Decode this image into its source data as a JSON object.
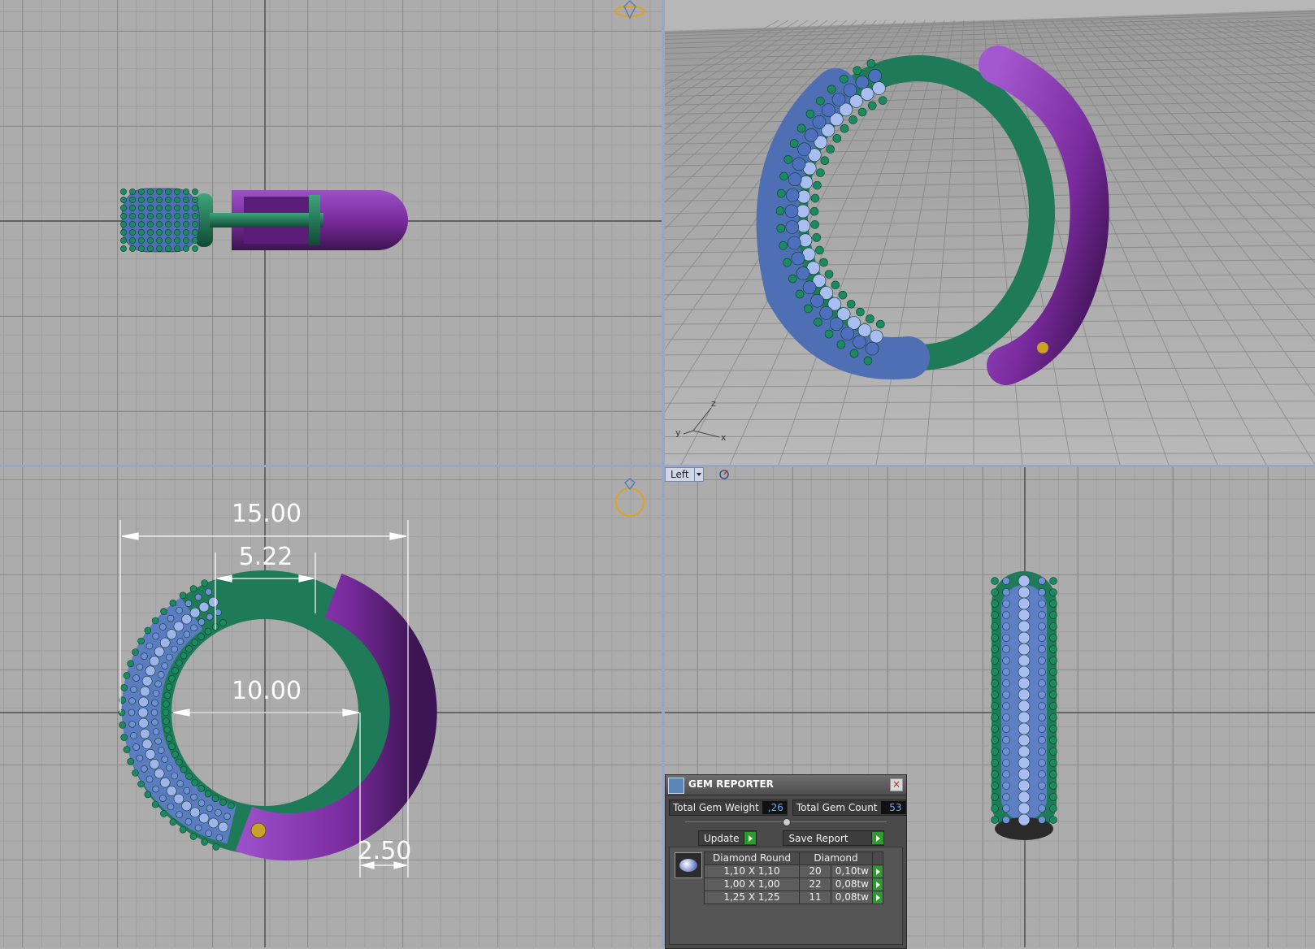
{
  "viewports": {
    "bottom_right_view": "Left"
  },
  "dimensions": {
    "outer_width": "15.00",
    "opening": "5.22",
    "inner_diameter": "10.00",
    "thickness": "2.50"
  },
  "axes": {
    "x": "x",
    "y": "y",
    "z": "z"
  },
  "gem_reporter": {
    "title": "GEM REPORTER",
    "close": "×",
    "total_weight_label": "Total Gem Weight",
    "total_weight_value": ",26",
    "total_count_label": "Total Gem Count",
    "total_count_value": "53",
    "update_label": "Update",
    "save_label": "Save Report",
    "columns": [
      "Diamond Round",
      "Diamond"
    ],
    "rows": [
      {
        "size": "1,10 X 1,10",
        "count": "20",
        "weight": "0,10tw"
      },
      {
        "size": "1,00 X 1,00",
        "count": "22",
        "weight": "0,08tw"
      },
      {
        "size": "1,25 X 1,25",
        "count": "11",
        "weight": "0,08tw"
      }
    ]
  },
  "colors": {
    "metal_green": "#1f7a5a",
    "metal_purple": "#7a2b9e",
    "gem_blue": "#6f8fd6",
    "viewport_border": "#9aa6c4"
  }
}
